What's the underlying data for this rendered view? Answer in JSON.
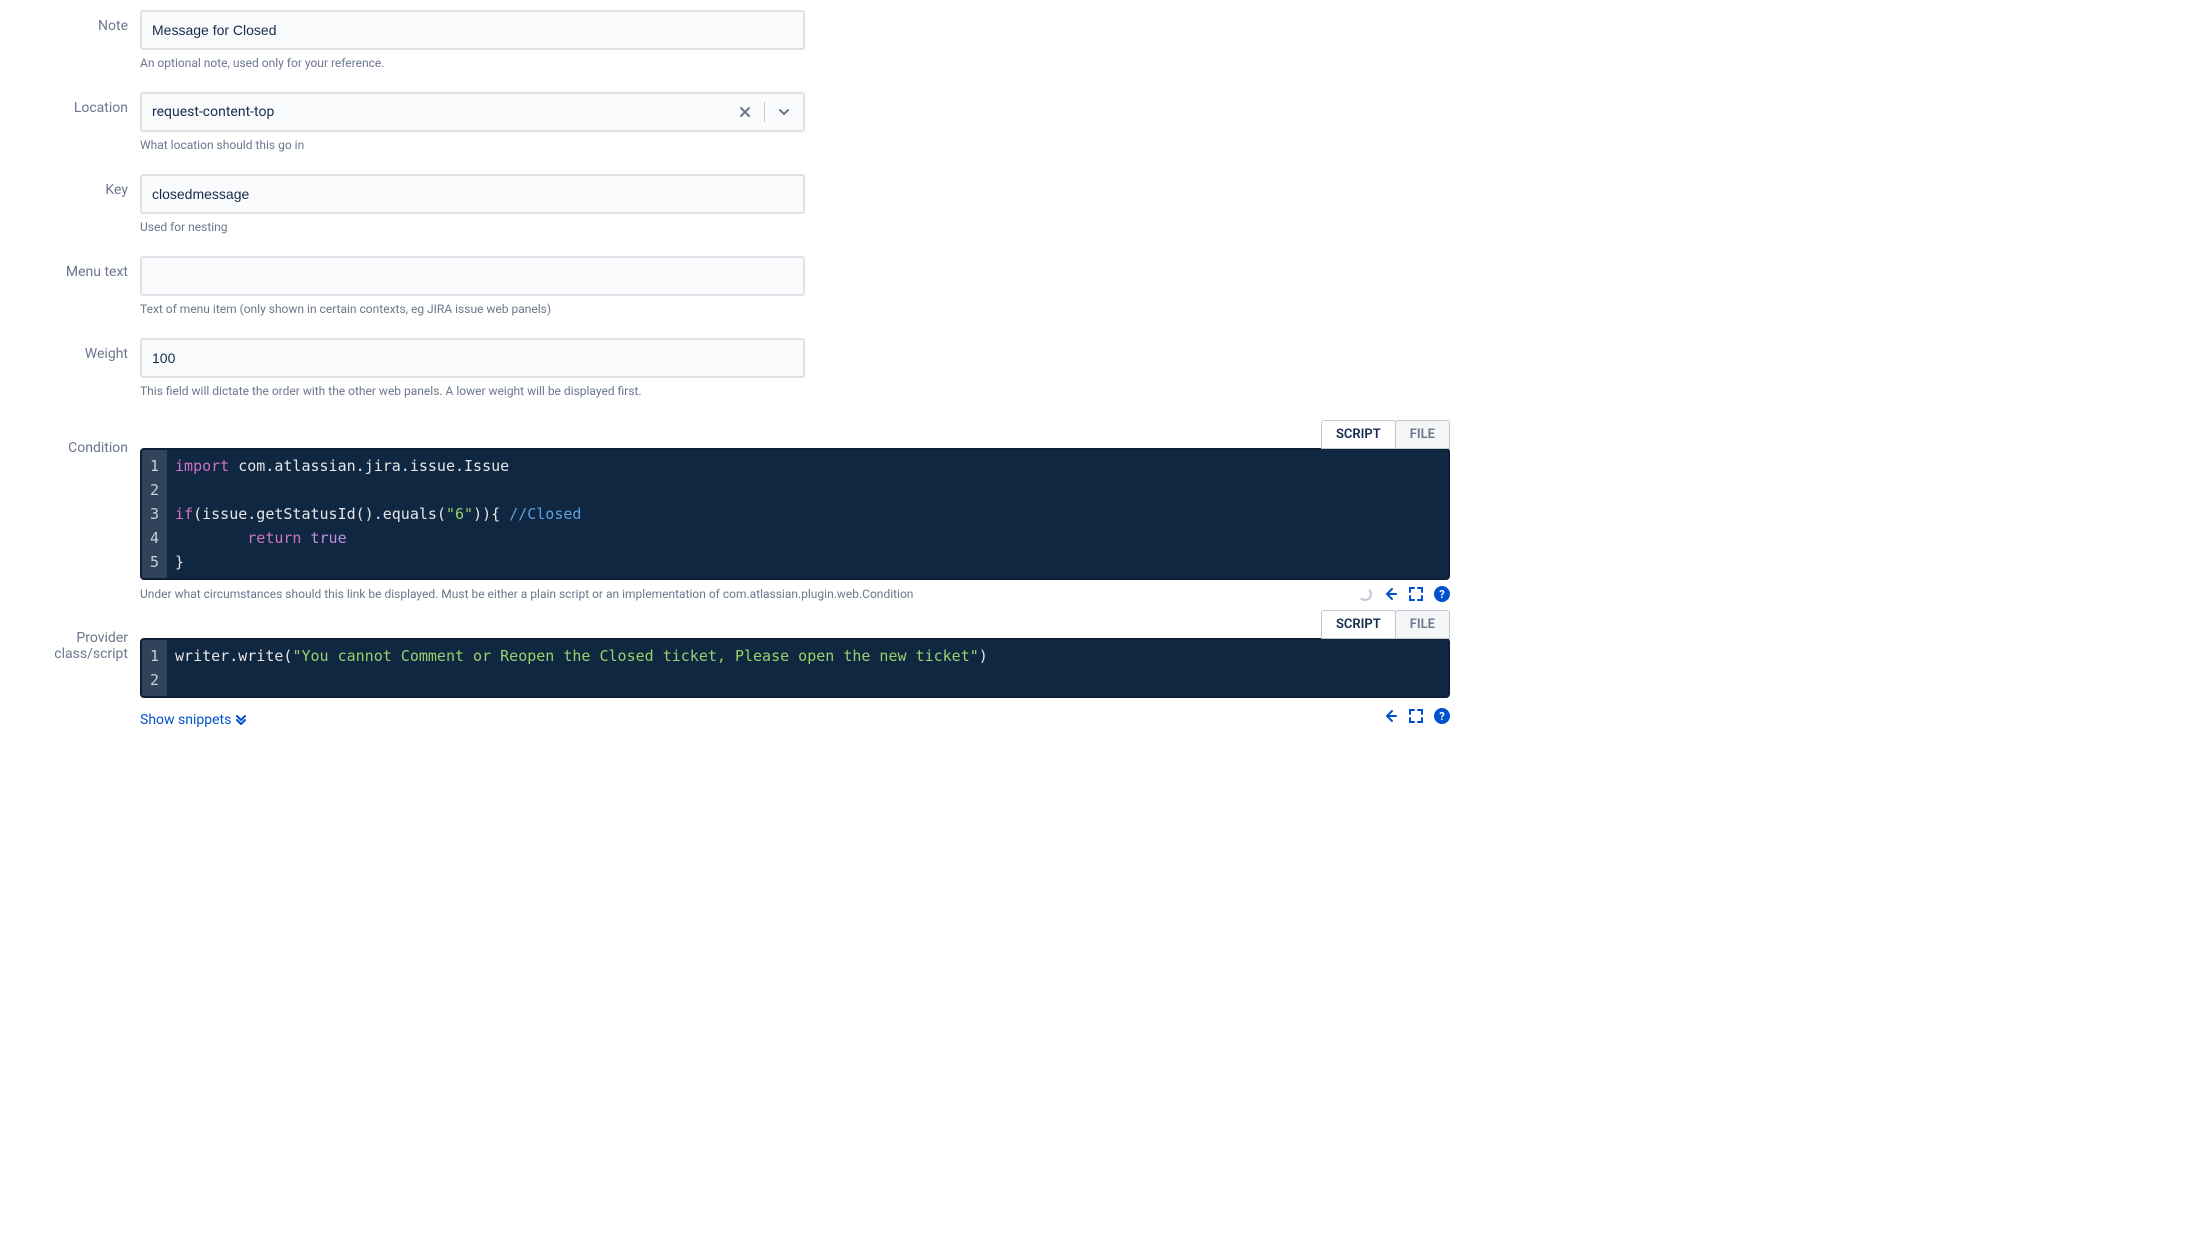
{
  "fields": {
    "note": {
      "label": "Note",
      "value": "Message for Closed",
      "help": "An optional note, used only for your reference."
    },
    "location": {
      "label": "Location",
      "value": "request-content-top",
      "help": "What location should this go in"
    },
    "key": {
      "label": "Key",
      "value": "closedmessage",
      "help": "Used for nesting"
    },
    "menutext": {
      "label": "Menu text",
      "value": "",
      "help": "Text of menu item (only shown in certain contexts, eg JIRA issue web panels)"
    },
    "weight": {
      "label": "Weight",
      "value": "100",
      "help": "This field will dictate the order with the other web panels. A lower weight will be displayed first."
    },
    "condition": {
      "label": "Condition",
      "tabs": {
        "script": "SCRIPT",
        "file": "FILE"
      },
      "code": {
        "kw_import": "import",
        "pkg": "com.atlassian.jira.issue.Issue",
        "kw_if": "if",
        "cond_expr_pre": "(issue.getStatusId().equals(",
        "cond_str": "\"6\"",
        "cond_expr_post": ")){ ",
        "comment": "//Closed",
        "indent": "        ",
        "kw_return": "return",
        "bool_true": "true",
        "close": "}"
      },
      "help": "Under what circumstances should this link be displayed. Must be either a plain script or an implementation of com.atlassian.plugin.web.Condition"
    },
    "provider": {
      "label": "Provider class/script",
      "tabs": {
        "script": "SCRIPT",
        "file": "FILE"
      },
      "code": {
        "call_pre": "writer.write(",
        "str": "\"You cannot Comment or Reopen the Closed ticket, Please open the new ticket\"",
        "call_post": ")"
      }
    }
  },
  "actions": {
    "show_snippets": "Show snippets"
  }
}
